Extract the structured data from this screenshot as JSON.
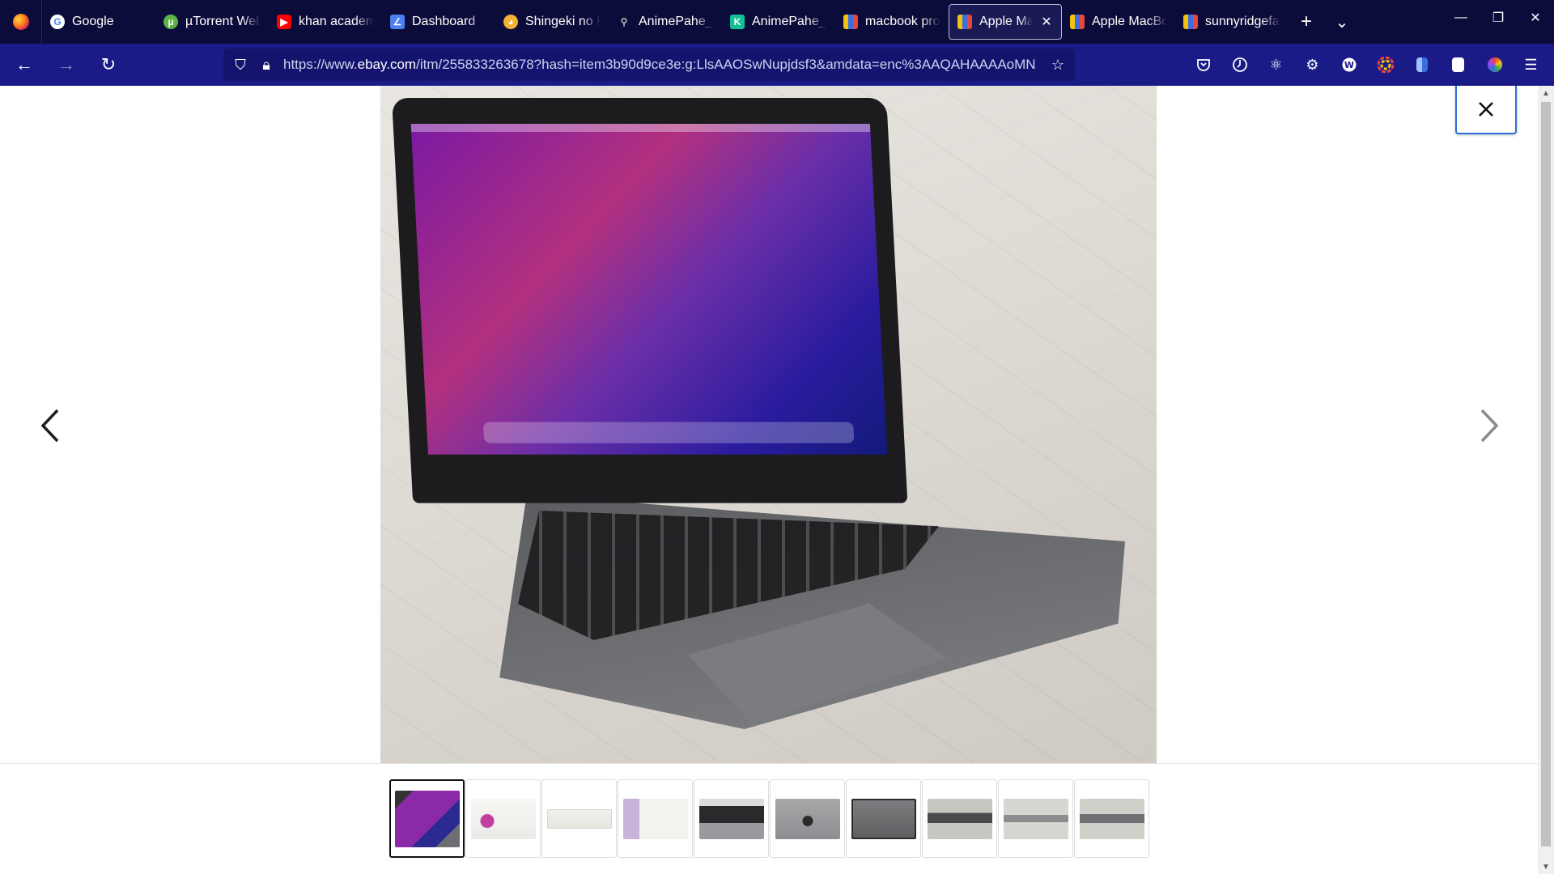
{
  "browser": {
    "tabs": [
      {
        "label": "Google",
        "icon": "google-icon"
      },
      {
        "label": "µTorrent Web",
        "icon": "utorrent-icon"
      },
      {
        "label": "khan academy",
        "icon": "youtube-icon"
      },
      {
        "label": "Dashboard",
        "icon": "dashboard-icon"
      },
      {
        "label": "Shingeki no Kyojin",
        "icon": "cat-icon"
      },
      {
        "label": "AnimePahe_S",
        "icon": "animepahe-icon"
      },
      {
        "label": "AnimePahe_S",
        "icon": "k-icon"
      },
      {
        "label": "macbook pro",
        "icon": "ebay-icon"
      },
      {
        "label": "Apple Mac",
        "icon": "ebay-icon"
      },
      {
        "label": "Apple MacBook",
        "icon": "ebay-icon"
      },
      {
        "label": "sunnyridgefarm",
        "icon": "ebay-icon"
      }
    ],
    "active_tab_index": 8,
    "new_tab_glyph": "+",
    "list_tabs_glyph": "⌄",
    "window_controls": {
      "minimize": "—",
      "restore": "❐",
      "close": "✕"
    },
    "nav": {
      "back_glyph": "←",
      "forward_glyph": "→",
      "reload_glyph": "↻"
    },
    "url": {
      "prefix": "https://www.",
      "host": "ebay.com",
      "path": "/itm/255833263678?hash=item3b90d9ce3e:g:LlsAAOSwNupjdsf3&amdata=enc%3AAQAHAAAAoMN"
    },
    "toolbar_icons": [
      "pocket-icon",
      "clock-icon",
      "react-devtools-icon",
      "gear-extension-icon",
      "wappalyzer-icon",
      "color-wheel-icon",
      "file-icon",
      "bookmark-extension-icon",
      "colorful-extension-icon",
      "menu-icon"
    ]
  },
  "viewer": {
    "image_alt": "MacBook Pro laptop open showing macOS desktop",
    "thumbnails": [
      {
        "name": "thumb-laptop-open",
        "selected": true
      },
      {
        "name": "thumb-about-this-mac",
        "selected": false
      },
      {
        "name": "thumb-serial-label",
        "selected": false
      },
      {
        "name": "thumb-system-report",
        "selected": false
      },
      {
        "name": "thumb-keyboard",
        "selected": false
      },
      {
        "name": "thumb-lid-top",
        "selected": false
      },
      {
        "name": "thumb-bottom-case",
        "selected": false
      },
      {
        "name": "thumb-side-closed",
        "selected": false
      },
      {
        "name": "thumb-side-profile",
        "selected": false
      },
      {
        "name": "thumb-side-ports",
        "selected": false
      }
    ]
  },
  "colors": {
    "tabstrip": "#0c0c3b",
    "navbar": "#1b1b87",
    "close_border": "#2a6fdb"
  }
}
